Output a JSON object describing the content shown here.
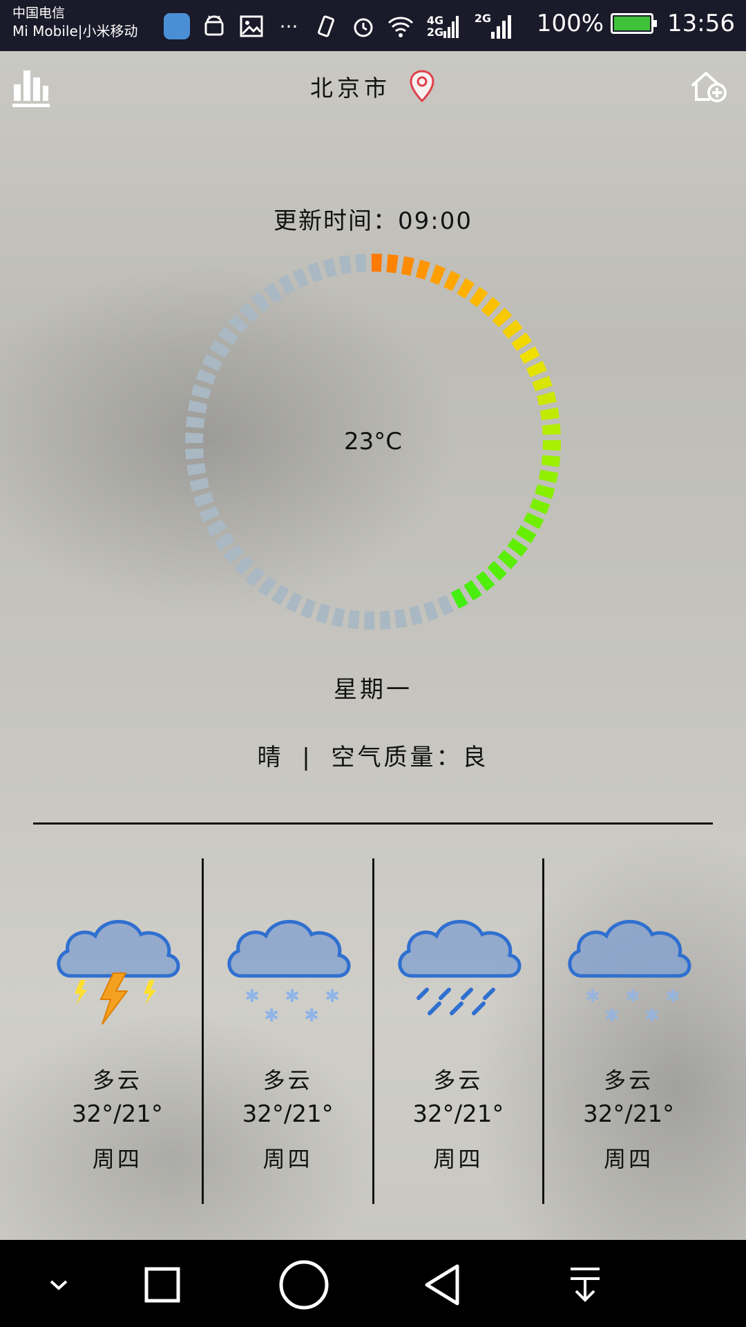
{
  "status_bar": {
    "carrier_line1": "中国电信",
    "carrier_line2": "Mi Mobile|小米移动",
    "net_4g": "4G",
    "net_2g_a": "2G",
    "net_2g_b": "2G",
    "battery": "100%",
    "time": "13:56",
    "icons": [
      "health-app-icon",
      "android-icon",
      "image-icon",
      "more-icon",
      "vibrate-icon",
      "alarm-icon",
      "wifi-icon",
      "signal-4g-icon",
      "signal-2g-icon",
      "battery-icon"
    ]
  },
  "header": {
    "city": "北京市",
    "left_icon": "stats-icon",
    "location_icon": "location-pin-icon",
    "right_icon": "add-city-icon"
  },
  "current": {
    "update_label": "更新时间：",
    "update_time": "09:00",
    "temperature": "23°C",
    "weekday": "星期一",
    "condition": "晴",
    "separator": "|",
    "air_label": "空气质量：",
    "air_value": "良"
  },
  "gauge": {
    "total_ticks": 72,
    "colored_fraction": 0.43,
    "inactive_color": "#a9b8c2",
    "gradient_colors": [
      "#ff7a00",
      "#ffb000",
      "#f0e000",
      "#a8f000",
      "#66ee00",
      "#44ee11"
    ]
  },
  "forecast": [
    {
      "icon": "thunderstorm-icon",
      "desc": "多云",
      "range": "32°/21°",
      "day": "周四"
    },
    {
      "icon": "snow-icon",
      "desc": "多云",
      "range": "32°/21°",
      "day": "周四"
    },
    {
      "icon": "rain-icon",
      "desc": "多云",
      "range": "32°/21°",
      "day": "周四"
    },
    {
      "icon": "light-snow-icon",
      "desc": "多云",
      "range": "32°/21°",
      "day": "周四"
    }
  ],
  "nav_bar": [
    "collapse-icon",
    "recents-icon",
    "home-icon",
    "back-icon",
    "notification-pull-icon"
  ],
  "colors": {
    "cloud_fill": "#7f9fcf",
    "cloud_stroke": "#2f6fd0",
    "bolt": "#f4a020",
    "snow": "#8fb4e8",
    "rain": "#2f6fd0",
    "pin": "#e0404a"
  }
}
